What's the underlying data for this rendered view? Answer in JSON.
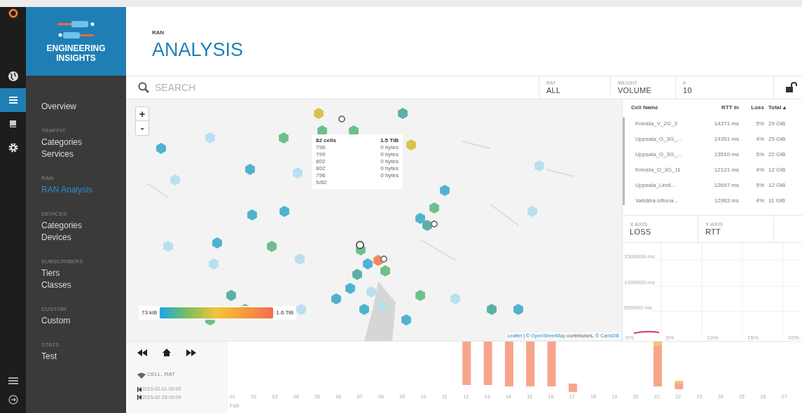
{
  "brand": {
    "line1": "ENGINEERING",
    "line2": "INSIGHTS"
  },
  "rail": [
    {
      "kind": "globe",
      "selected": false
    },
    {
      "kind": "list",
      "selected": true
    },
    {
      "kind": "book",
      "selected": false
    },
    {
      "kind": "gear",
      "selected": false
    }
  ],
  "sidebar": {
    "items": [
      {
        "kind": "item",
        "label": "Overview",
        "selected": false
      },
      {
        "kind": "section",
        "label": "TRAFFIC"
      },
      {
        "kind": "item",
        "label": "Categories",
        "selected": false
      },
      {
        "kind": "item",
        "label": "Services",
        "selected": false
      },
      {
        "kind": "section",
        "label": "RAN"
      },
      {
        "kind": "item",
        "label": "RAN Analysis",
        "selected": true
      },
      {
        "kind": "section",
        "label": "DEVICES"
      },
      {
        "kind": "item",
        "label": "Categories",
        "selected": false
      },
      {
        "kind": "item",
        "label": "Devices",
        "selected": false
      },
      {
        "kind": "section",
        "label": "SUBSCRIBERS"
      },
      {
        "kind": "item",
        "label": "Tiers",
        "selected": false
      },
      {
        "kind": "item",
        "label": "Classes",
        "selected": false
      },
      {
        "kind": "section",
        "label": "CUSTOM"
      },
      {
        "kind": "item",
        "label": "Custom",
        "selected": false
      },
      {
        "kind": "section",
        "label": "STATS"
      },
      {
        "kind": "item",
        "label": "Test",
        "selected": false
      }
    ]
  },
  "header": {
    "breadcrumb": "RAN",
    "title": "ANALYSIS"
  },
  "filters": {
    "search_placeholder": "SEARCH",
    "selectors": [
      {
        "label": "RAT",
        "value": "ALL"
      },
      {
        "label": "WEIGHT",
        "value": "VOLUME"
      },
      {
        "label": "#",
        "value": "10"
      }
    ]
  },
  "map": {
    "zoom_in": "+",
    "zoom_out": "-",
    "tooltip": {
      "title": "82 cells",
      "total": "1.5 TiB",
      "rows": [
        {
          "id": "796",
          "value": "0 bytes"
        },
        {
          "id": "799",
          "value": "0 bytes"
        },
        {
          "id": "802",
          "value": "0 bytes"
        },
        {
          "id": "802",
          "value": "0 bytes"
        },
        {
          "id": "796",
          "value": "0 bytes"
        }
      ],
      "footer": "5/82"
    },
    "legend": {
      "min": "73 kiB",
      "max": "1.6 TiB"
    },
    "attribution": {
      "leaflet": "Leaflet",
      "text": "| © ",
      "osm": "OpenStreetMap",
      "contrib": "contributors, ©",
      "carto": "CartoDB"
    }
  },
  "table": {
    "columns": [
      "Cell Name",
      "RTT In",
      "Loss",
      "Total ▴"
    ],
    "rows": [
      [
        "Knivsta_V_2G_3",
        "14371 ms",
        "5%",
        "29 GiB"
      ],
      [
        "Uppsala_O_3G_...",
        "14351 ms",
        "4%",
        "25 GiB"
      ],
      [
        "Uppsala_O_3G_...",
        "13510 ms",
        "5%",
        "22 GiB"
      ],
      [
        "Knivsta_O_3G_11",
        "12121 ms",
        "4%",
        "12 GiB"
      ],
      [
        "Uppsala_Lindi...",
        "12697 ms",
        "5%",
        "12 GiB"
      ],
      [
        "Valsätra-Ultuna...",
        "12963 ms",
        "4%",
        "11 GiB"
      ]
    ]
  },
  "axes": [
    {
      "label": "X AXIS",
      "value": "LOSS"
    },
    {
      "label": "Y AXIS",
      "value": "RTT"
    }
  ],
  "scatter": {
    "y_ticks": [
      "1500000 ms",
      "1000000 ms",
      "500000 ms"
    ],
    "x_ticks": [
      "0%",
      "5%",
      "10%",
      "15%",
      "20%"
    ]
  },
  "timeline": {
    "filter_label": "CELL, RAT",
    "start": "2015-02-01 00:00",
    "end": "2015-02-28 00:00",
    "day_labels": [
      "01",
      "02",
      "03",
      "04",
      "05",
      "06",
      "07",
      "08",
      "09",
      "10",
      "11",
      "12",
      "13",
      "14",
      "15",
      "16",
      "17",
      "18",
      "19",
      "20",
      "21",
      "22",
      "23",
      "24",
      "25",
      "26",
      "27"
    ],
    "month_label": "Feb"
  }
}
